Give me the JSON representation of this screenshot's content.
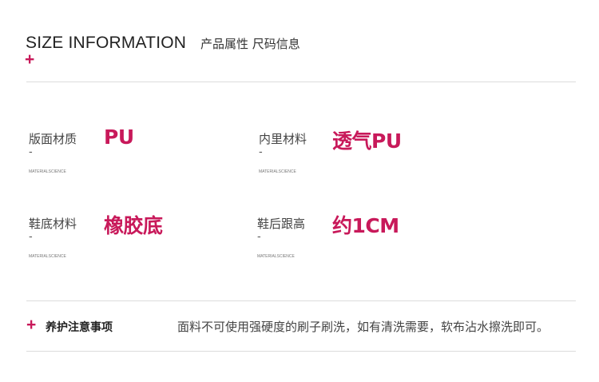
{
  "header": {
    "title_en": "SIZE INFORMATION",
    "title_cn": "产品属性 尺码信息",
    "plus": "+"
  },
  "attributes": [
    {
      "label": "版面材质",
      "dash": "-",
      "sub": "MATERIALSCIENCE",
      "value": "PU"
    },
    {
      "label": "内里材料",
      "dash": "-",
      "sub": "MATERIALSCIENCE",
      "value": "透气PU"
    },
    {
      "label": "鞋底材料",
      "dash": "-",
      "sub": "MATERIALSCIENCE",
      "value": "橡胶底"
    },
    {
      "label": "鞋后跟高",
      "dash": "-",
      "sub": "MATERIALSCIENCE",
      "value": "约1CM"
    }
  ],
  "care": {
    "plus": "+",
    "title": "养护注意事项",
    "text": "面料不可使用强硬度的刷子刷洗，如有清洗需要，软布沾水擦洗即可。"
  },
  "colors": {
    "accent": "#c8195a",
    "divider": "#dcdcdc",
    "text": "#333333"
  }
}
